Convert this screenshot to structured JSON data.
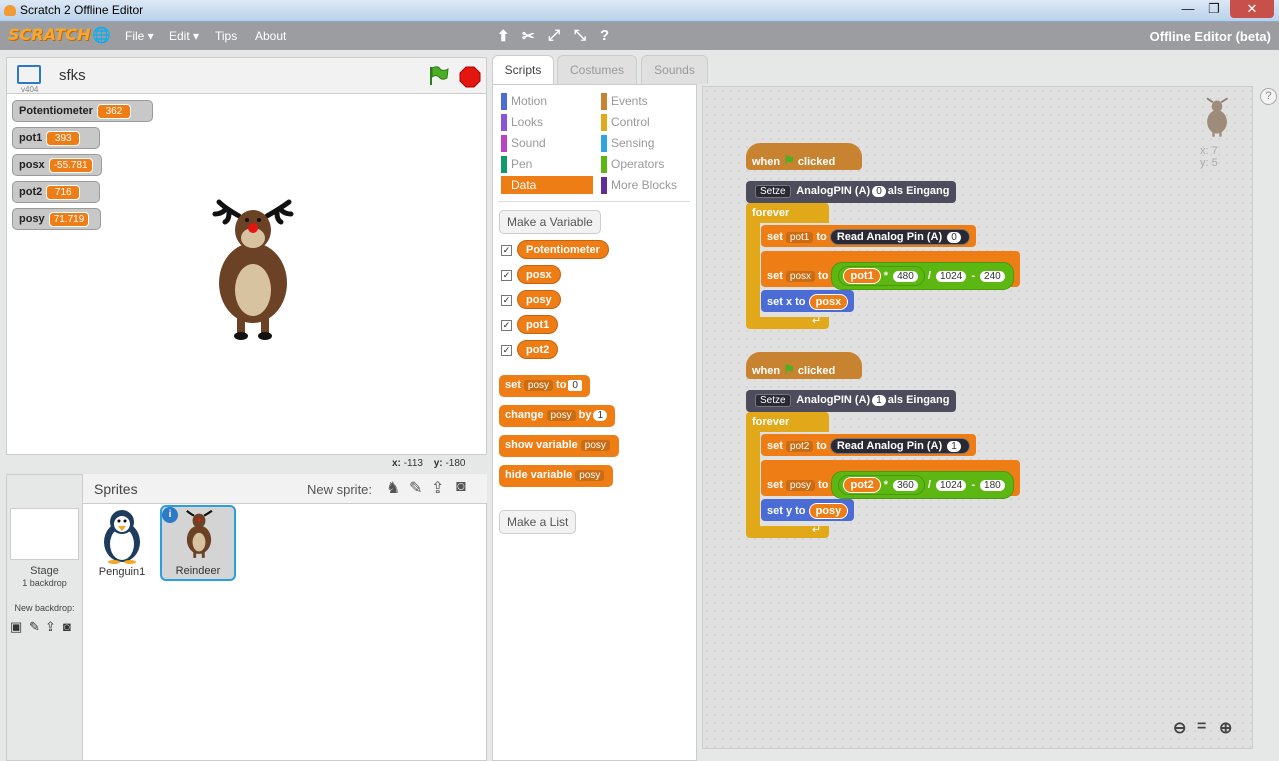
{
  "window": {
    "title": "Scratch 2 Offline Editor",
    "minimize": "—",
    "maximize": "❐",
    "close": "✕"
  },
  "menu": {
    "logo": "SCRATCH",
    "file": "File ▾",
    "edit": "Edit ▾",
    "tips": "Tips",
    "about": "About",
    "right_label": "Offline Editor (beta)"
  },
  "stage": {
    "project_name": "sfks",
    "version": "v404",
    "coords_x_label": "x:",
    "coords_x": "-113",
    "coords_y_label": "y:",
    "coords_y": "-180"
  },
  "monitors": [
    {
      "label": "Potentiometer",
      "value": "362"
    },
    {
      "label": "pot1",
      "value": "393"
    },
    {
      "label": "posx",
      "value": "-55.781"
    },
    {
      "label": "pot2",
      "value": "716"
    },
    {
      "label": "posy",
      "value": "71.719"
    }
  ],
  "sprites": {
    "heading": "Sprites",
    "new_sprite": "New sprite:",
    "stage_label": "Stage",
    "stage_sub": "1 backdrop",
    "new_backdrop": "New backdrop:",
    "items": [
      {
        "name": "Penguin1"
      },
      {
        "name": "Reindeer"
      }
    ]
  },
  "tabs": {
    "scripts": "Scripts",
    "costumes": "Costumes",
    "sounds": "Sounds"
  },
  "categories": {
    "motion": "Motion",
    "looks": "Looks",
    "sound": "Sound",
    "pen": "Pen",
    "data": "Data",
    "events": "Events",
    "control": "Control",
    "sensing": "Sensing",
    "operators": "Operators",
    "more": "More Blocks"
  },
  "palette": {
    "make_variable": "Make a Variable",
    "make_list": "Make a List",
    "variables": [
      "Potentiometer",
      "posx",
      "posy",
      "pot1",
      "pot2"
    ],
    "set": "set",
    "set_var": "posy",
    "to": "to",
    "set_val": "0",
    "change": "change",
    "change_var": "posy",
    "by": "by",
    "change_val": "1",
    "show": "show variable",
    "show_var": "posy",
    "hide": "hide variable",
    "hide_var": "posy"
  },
  "script1": {
    "when": "when",
    "clicked": "clicked",
    "setze": "Setze",
    "analogpin": "AnalogPIN (A)",
    "pin": "0",
    "als": "als Eingang",
    "forever": "forever",
    "set": "set",
    "var1": "pot1",
    "to": "to",
    "read": "Read Analog Pin (A)",
    "read_pin": "0",
    "var2": "posx",
    "rep": "pot1",
    "mul": "*",
    "n1": "480",
    "div": "/",
    "n2": "1024",
    "minus": "-",
    "n3": "240",
    "setxy": "set x to",
    "xyvar": "posx"
  },
  "script2": {
    "when": "when",
    "clicked": "clicked",
    "setze": "Setze",
    "analogpin": "AnalogPIN (A)",
    "pin": "1",
    "als": "als Eingang",
    "forever": "forever",
    "set": "set",
    "var1": "pot2",
    "to": "to",
    "read": "Read Analog Pin (A)",
    "read_pin": "1",
    "var2": "posy",
    "rep": "pot2",
    "mul": "*",
    "n1": "360",
    "div": "/",
    "n2": "1024",
    "minus": "-",
    "n3": "180",
    "setxy": "set y to",
    "xyvar": "posy"
  },
  "sprite_info": {
    "x_label": "x:",
    "x": "7",
    "y_label": "y:",
    "y": "5"
  },
  "colors": {
    "data": "#ee7d16",
    "control": "#e1a91a",
    "events": "#c88330",
    "motion": "#4a6cd4",
    "operators": "#5cb712",
    "extension": "#4c4c5c"
  }
}
